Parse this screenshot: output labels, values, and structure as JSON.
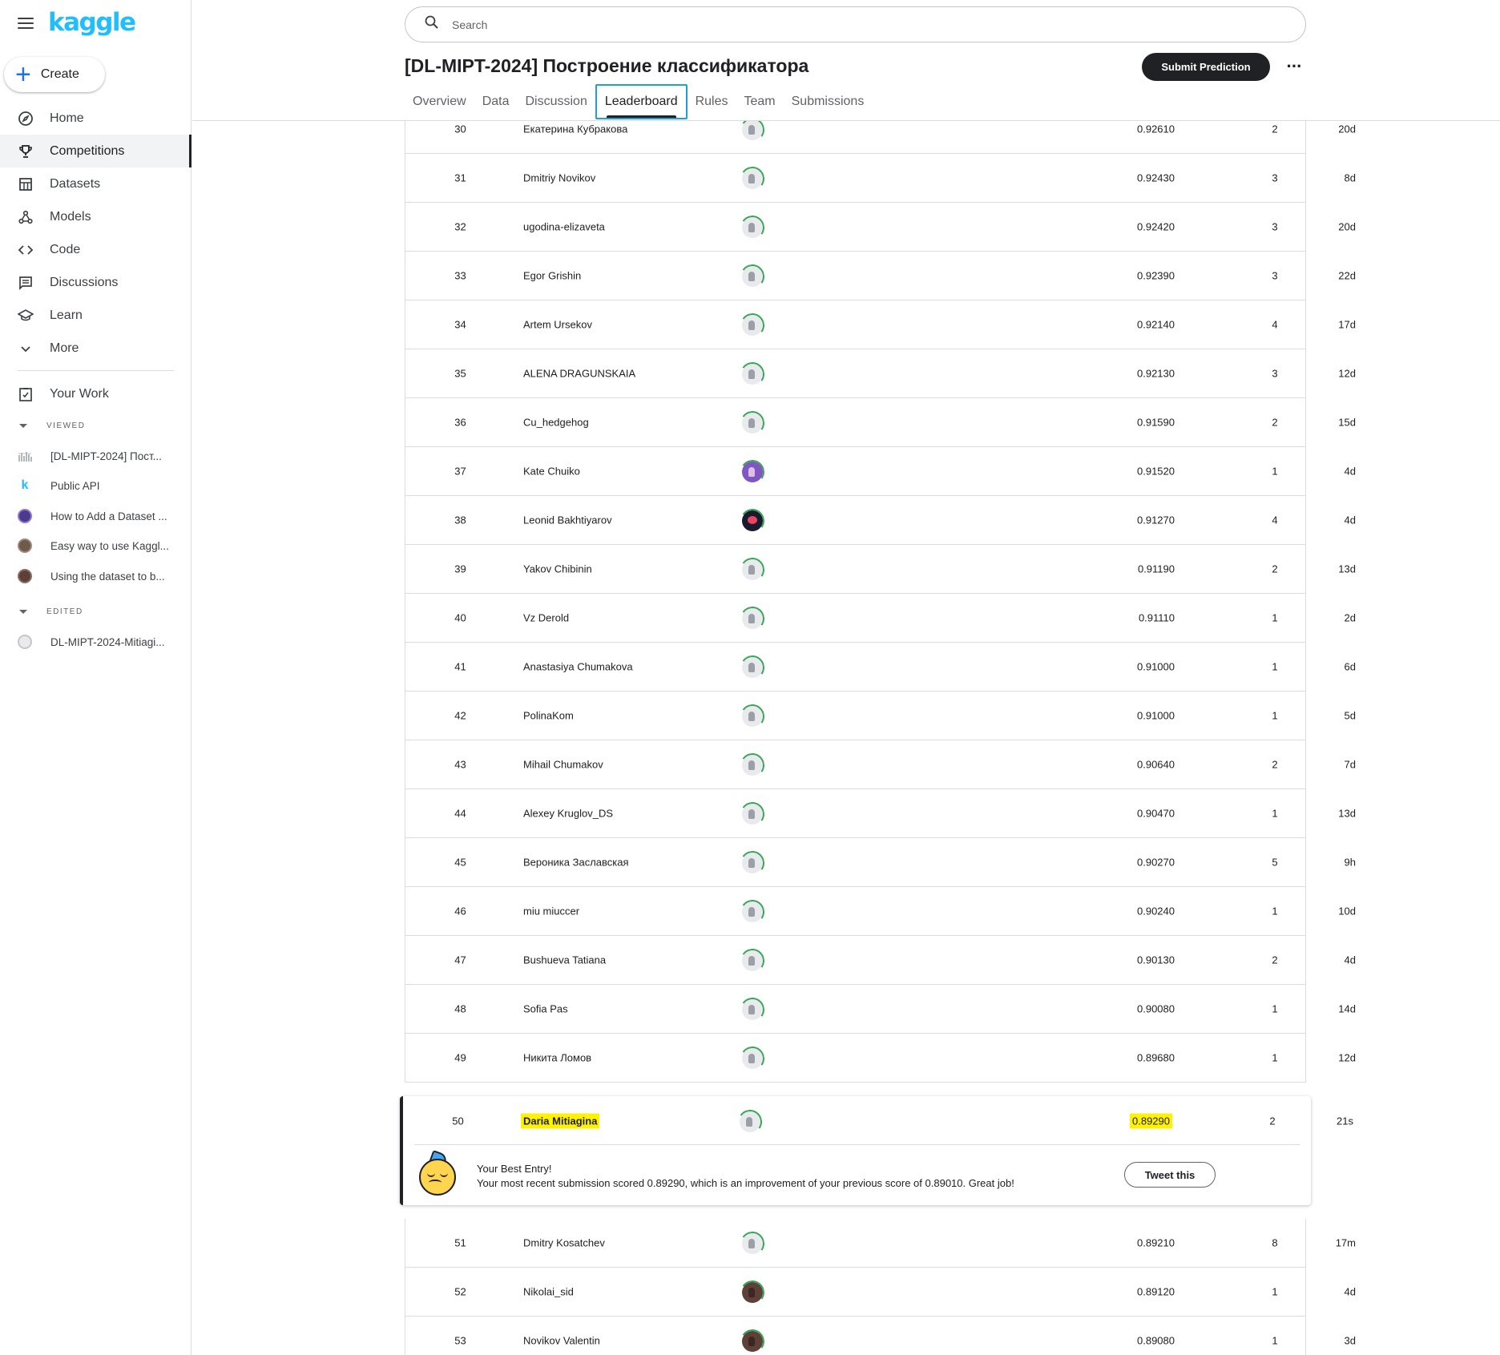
{
  "sidebar": {
    "logo": "kaggle",
    "create_label": "Create",
    "nav": [
      {
        "label": "Home",
        "icon": "compass-icon"
      },
      {
        "label": "Competitions",
        "icon": "trophy-icon",
        "active": true
      },
      {
        "label": "Datasets",
        "icon": "table-icon"
      },
      {
        "label": "Models",
        "icon": "models-icon"
      },
      {
        "label": "Code",
        "icon": "code-icon"
      },
      {
        "label": "Discussions",
        "icon": "discussions-icon"
      },
      {
        "label": "Learn",
        "icon": "school-icon"
      },
      {
        "label": "More",
        "icon": "chevron-down-icon"
      }
    ],
    "your_work": "Your Work",
    "viewed_heading": "VIEWED",
    "viewed": [
      {
        "label": "[DL-MIPT-2024] Пост..."
      },
      {
        "label": "Public API"
      },
      {
        "label": "How to Add a Dataset ..."
      },
      {
        "label": "Easy way to use Kaggl..."
      },
      {
        "label": "Using the dataset to b..."
      }
    ],
    "edited_heading": "EDITED",
    "edited": [
      {
        "label": "DL-MIPT-2024-Mitiagi..."
      }
    ]
  },
  "header": {
    "search_placeholder": "Search",
    "title": "[DL-MIPT-2024] Построение классификатора",
    "submit_label": "Submit Prediction",
    "more_label": "···",
    "tabs": [
      "Overview",
      "Data",
      "Discussion",
      "Leaderboard",
      "Rules",
      "Team",
      "Submissions"
    ],
    "active_tab": "Leaderboard"
  },
  "leaderboard": {
    "rows_before": [
      {
        "rank": "30",
        "name": "Екатерина Кубракова",
        "score": "0.92610",
        "entries": "2",
        "last": "20d",
        "avatar": "default"
      },
      {
        "rank": "31",
        "name": "Dmitriy Novikov",
        "score": "0.92430",
        "entries": "3",
        "last": "8d",
        "avatar": "default"
      },
      {
        "rank": "32",
        "name": "ugodina-elizaveta",
        "score": "0.92420",
        "entries": "3",
        "last": "20d",
        "avatar": "default"
      },
      {
        "rank": "33",
        "name": "Egor Grishin",
        "score": "0.92390",
        "entries": "3",
        "last": "22d",
        "avatar": "default"
      },
      {
        "rank": "34",
        "name": "Artem Ursekov",
        "score": "0.92140",
        "entries": "4",
        "last": "17d",
        "avatar": "default"
      },
      {
        "rank": "35",
        "name": "ALENA DRAGUNSKAIA",
        "score": "0.92130",
        "entries": "3",
        "last": "12d",
        "avatar": "default"
      },
      {
        "rank": "36",
        "name": "Cu_hedgehog",
        "score": "0.91590",
        "entries": "2",
        "last": "15d",
        "avatar": "default"
      },
      {
        "rank": "37",
        "name": "Kate Chuiko",
        "score": "0.91520",
        "entries": "1",
        "last": "4d",
        "avatar": "purple"
      },
      {
        "rank": "38",
        "name": "Leonid Bakhtiyarov",
        "score": "0.91270",
        "entries": "4",
        "last": "4d",
        "avatar": "dark"
      },
      {
        "rank": "39",
        "name": "Yakov Chibinin",
        "score": "0.91190",
        "entries": "2",
        "last": "13d",
        "avatar": "default"
      },
      {
        "rank": "40",
        "name": "Vz Derold",
        "score": "0.91110",
        "entries": "1",
        "last": "2d",
        "avatar": "default"
      },
      {
        "rank": "41",
        "name": "Anastasiya Chumakova",
        "score": "0.91000",
        "entries": "1",
        "last": "6d",
        "avatar": "default"
      },
      {
        "rank": "42",
        "name": "PolinaKom",
        "score": "0.91000",
        "entries": "1",
        "last": "5d",
        "avatar": "default"
      },
      {
        "rank": "43",
        "name": "Mihail Chumakov",
        "score": "0.90640",
        "entries": "2",
        "last": "7d",
        "avatar": "default"
      },
      {
        "rank": "44",
        "name": "Alexey Kruglov_DS",
        "score": "0.90470",
        "entries": "1",
        "last": "13d",
        "avatar": "default"
      },
      {
        "rank": "45",
        "name": "Вероника Заславская",
        "score": "0.90270",
        "entries": "5",
        "last": "9h",
        "avatar": "default"
      },
      {
        "rank": "46",
        "name": "miu miuccer",
        "score": "0.90240",
        "entries": "1",
        "last": "10d",
        "avatar": "default"
      },
      {
        "rank": "47",
        "name": "Bushueva Tatiana",
        "score": "0.90130",
        "entries": "2",
        "last": "4d",
        "avatar": "default"
      },
      {
        "rank": "48",
        "name": "Sofia Pas",
        "score": "0.90080",
        "entries": "1",
        "last": "14d",
        "avatar": "default"
      },
      {
        "rank": "49",
        "name": "Никита Ломов",
        "score": "0.89680",
        "entries": "1",
        "last": "12d",
        "avatar": "default"
      }
    ],
    "me": {
      "rank": "50",
      "name": "Daria Mitiagina",
      "score": "0.89290",
      "entries": "2",
      "last": "21s",
      "best_title": "Your Best Entry!",
      "best_message": "Your most recent submission scored 0.89290, which is an improvement of your previous score of 0.89010. Great job!",
      "tweet_label": "Tweet this"
    },
    "rows_after": [
      {
        "rank": "51",
        "name": "Dmitry Kosatchev",
        "score": "0.89210",
        "entries": "8",
        "last": "17m",
        "avatar": "default"
      },
      {
        "rank": "52",
        "name": "Nikolai_sid",
        "score": "0.89120",
        "entries": "1",
        "last": "4d",
        "avatar": "photo"
      },
      {
        "rank": "53",
        "name": "Novikov Valentin",
        "score": "0.89080",
        "entries": "1",
        "last": "3d",
        "avatar": "photo"
      }
    ]
  },
  "colors": {
    "brand": "#20beff",
    "highlight": "#fff200",
    "active_tab_outline": "#20a0d8",
    "avatar_ring": "#34a853"
  }
}
